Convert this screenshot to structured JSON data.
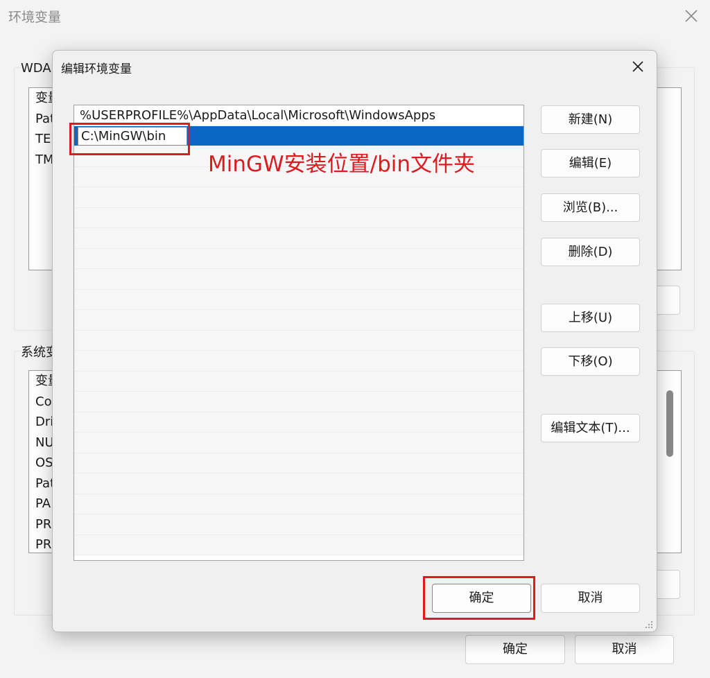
{
  "background_window": {
    "title": "环境变量",
    "user_group_label": "WDA",
    "user_list": {
      "header": "变量",
      "rows": [
        "Pat",
        "TEI",
        "TM"
      ]
    },
    "system_group_label": "系统变",
    "system_list": {
      "header": "变量",
      "rows": [
        "Co",
        "Dri",
        "NU",
        "OS",
        "Pat",
        "PA",
        "PR",
        "PR"
      ]
    },
    "ok_label": "确定",
    "cancel_label": "取消"
  },
  "dialog": {
    "title": "编辑环境变量",
    "path_entries": [
      "%USERPROFILE%\\AppData\\Local\\Microsoft\\WindowsApps"
    ],
    "editing_value": "C:\\MinGW\\bin",
    "empty_row_count": 20,
    "buttons": {
      "new": "新建(N)",
      "edit": "编辑(E)",
      "browse": "浏览(B)...",
      "delete": "删除(D)",
      "move_up": "上移(U)",
      "move_down": "下移(O)",
      "edit_text": "编辑文本(T)..."
    },
    "ok_label": "确定",
    "cancel_label": "取消"
  },
  "annotation": {
    "label": "MinGW安装位置/bin文件夹",
    "color": "#e0191f"
  },
  "colors": {
    "selection": "#0a68c4",
    "window_bg": "#f3f3f3"
  },
  "icons": {
    "close": "close-icon",
    "resize": "resize-grip-icon"
  }
}
